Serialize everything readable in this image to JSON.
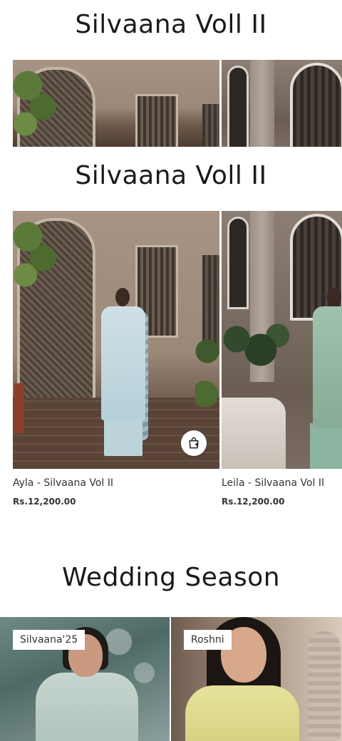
{
  "sections": {
    "first_title": "Silvaana Voll II",
    "second_title": "Silvaana Voll II",
    "third_title": "Wedding Season"
  },
  "products": [
    {
      "name": "Ayla - Silvaana Vol II",
      "price": "Rs.12,200.00"
    },
    {
      "name": "Leila - Silvaana Vol II",
      "price": "Rs.12,200.00"
    }
  ],
  "collections": [
    {
      "label": "Silvaana'25"
    },
    {
      "label": "Roshni"
    }
  ],
  "icons": {
    "add_to_bag": "shopping-bag-plus-icon"
  }
}
